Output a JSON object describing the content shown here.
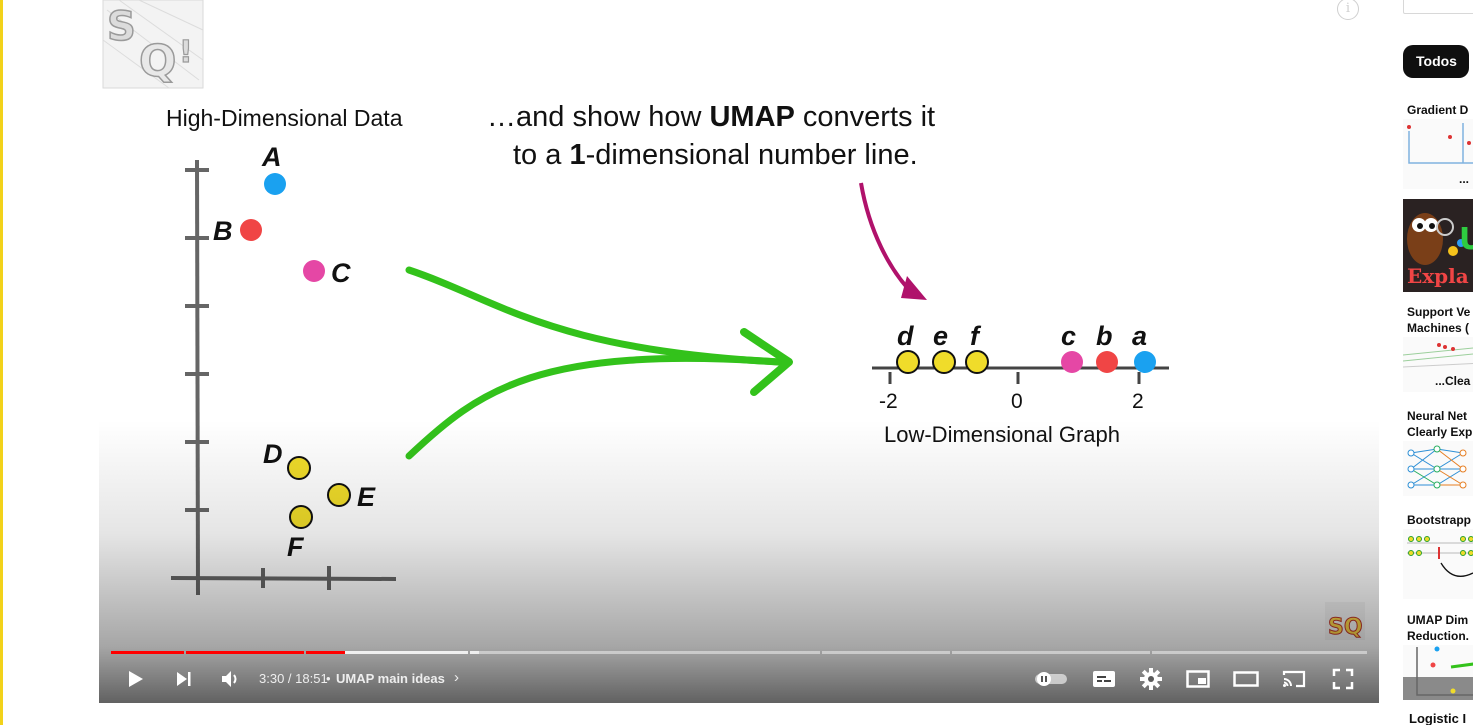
{
  "video": {
    "slide": {
      "left_heading": "High-Dimensional Data",
      "headline_line1_pre": "…and show how ",
      "headline_line1_bold": "UMAP",
      "headline_line1_post": " converts it",
      "headline_line2_pre": "to a ",
      "headline_line2_bold": "1",
      "headline_line2_post": "-dimensional number line.",
      "point_labels_high": [
        "A",
        "B",
        "C",
        "D",
        "E",
        "F"
      ],
      "point_labels_low": [
        "d",
        "e",
        "f",
        "c",
        "b",
        "a"
      ],
      "number_line_ticks": [
        "-2",
        "0",
        "2"
      ],
      "right_caption": "Low-Dimensional Graph",
      "colors": {
        "blue": "#1aa1f0",
        "red": "#f04545",
        "pink": "#e547a5",
        "yellow": "#f0dc2a",
        "green": "#33c21b",
        "magenta_arrow": "#b0126b"
      }
    },
    "controls": {
      "play_icon": "play-icon",
      "next_icon": "next-icon",
      "volume_icon": "volume-icon",
      "time": "3:30 / 18:51",
      "chapter_separator": "•",
      "chapter": "UMAP main ideas",
      "chapter_chevron": "›",
      "autoplay_icon": "autoplay-toggle-icon",
      "subtitles_icon": "subtitles-icon",
      "settings_icon": "gear-icon",
      "miniplayer_icon": "miniplayer-icon",
      "theater_icon": "theater-icon",
      "cast_icon": "cast-icon",
      "fullscreen_icon": "fullscreen-icon",
      "progress_fraction": 0.186
    },
    "watermark_text": "StatQuest"
  },
  "sidebar": {
    "chip_label": "Todos",
    "recommendations": [
      {
        "title_line1": "Gradient D",
        "title_line2": ""
      },
      {
        "title_line1": "",
        "title_line2": ""
      },
      {
        "title_line1": "Support Ve",
        "title_line2": "Machines ("
      },
      {
        "title_line1": "Neural Net",
        "title_line2": "Clearly Exp"
      },
      {
        "title_line1": "Bootstrapp",
        "title_line2": ""
      },
      {
        "title_line1": "UMAP Dim",
        "title_line2": "Reduction."
      }
    ],
    "thumb_text_1": "...",
    "thumb_text_2": "U",
    "thumb_text_2b": "Expla",
    "thumb_text_3": "...Clea",
    "bottom_title": "Logistic I"
  }
}
